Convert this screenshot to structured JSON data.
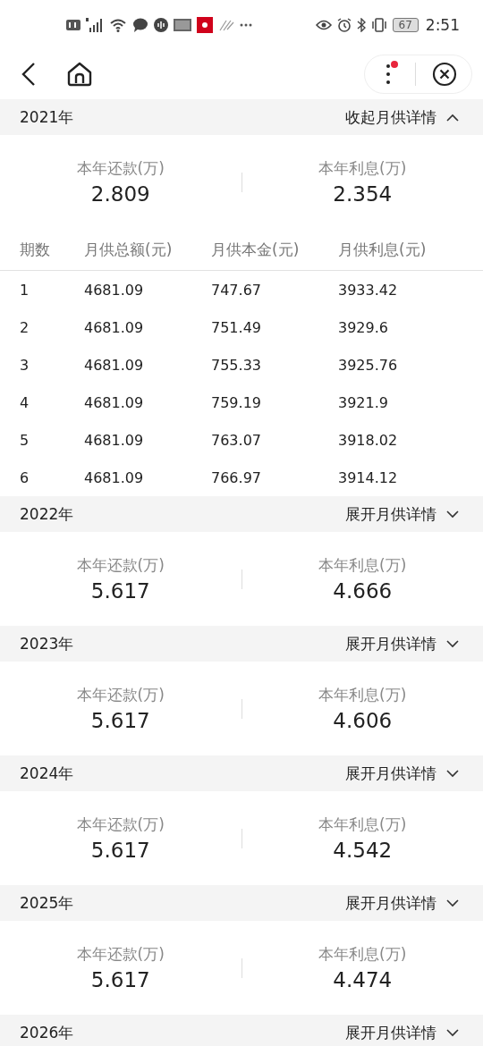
{
  "status_bar": {
    "battery": "67",
    "time": "2:51"
  },
  "columns": [
    "期数",
    "月供总额(元)",
    "月供本金(元)",
    "月供利息(元)"
  ],
  "years": [
    {
      "year": "2021年",
      "toggle": "收起月供详情",
      "expanded": true,
      "summary": [
        {
          "label": "本年还款(万)",
          "value": "2.809"
        },
        {
          "label": "本年利息(万)",
          "value": "2.354"
        }
      ],
      "rows": [
        [
          "1",
          "4681.09",
          "747.67",
          "3933.42"
        ],
        [
          "2",
          "4681.09",
          "751.49",
          "3929.6"
        ],
        [
          "3",
          "4681.09",
          "755.33",
          "3925.76"
        ],
        [
          "4",
          "4681.09",
          "759.19",
          "3921.9"
        ],
        [
          "5",
          "4681.09",
          "763.07",
          "3918.02"
        ],
        [
          "6",
          "4681.09",
          "766.97",
          "3914.12"
        ]
      ]
    },
    {
      "year": "2022年",
      "toggle": "展开月供详情",
      "expanded": false,
      "summary": [
        {
          "label": "本年还款(万)",
          "value": "5.617"
        },
        {
          "label": "本年利息(万)",
          "value": "4.666"
        }
      ]
    },
    {
      "year": "2023年",
      "toggle": "展开月供详情",
      "expanded": false,
      "summary": [
        {
          "label": "本年还款(万)",
          "value": "5.617"
        },
        {
          "label": "本年利息(万)",
          "value": "4.606"
        }
      ]
    },
    {
      "year": "2024年",
      "toggle": "展开月供详情",
      "expanded": false,
      "summary": [
        {
          "label": "本年还款(万)",
          "value": "5.617"
        },
        {
          "label": "本年利息(万)",
          "value": "4.542"
        }
      ]
    },
    {
      "year": "2025年",
      "toggle": "展开月供详情",
      "expanded": false,
      "summary": [
        {
          "label": "本年还款(万)",
          "value": "5.617"
        },
        {
          "label": "本年利息(万)",
          "value": "4.474"
        }
      ]
    },
    {
      "year": "2026年",
      "toggle": "展开月供详情",
      "expanded": false
    }
  ]
}
